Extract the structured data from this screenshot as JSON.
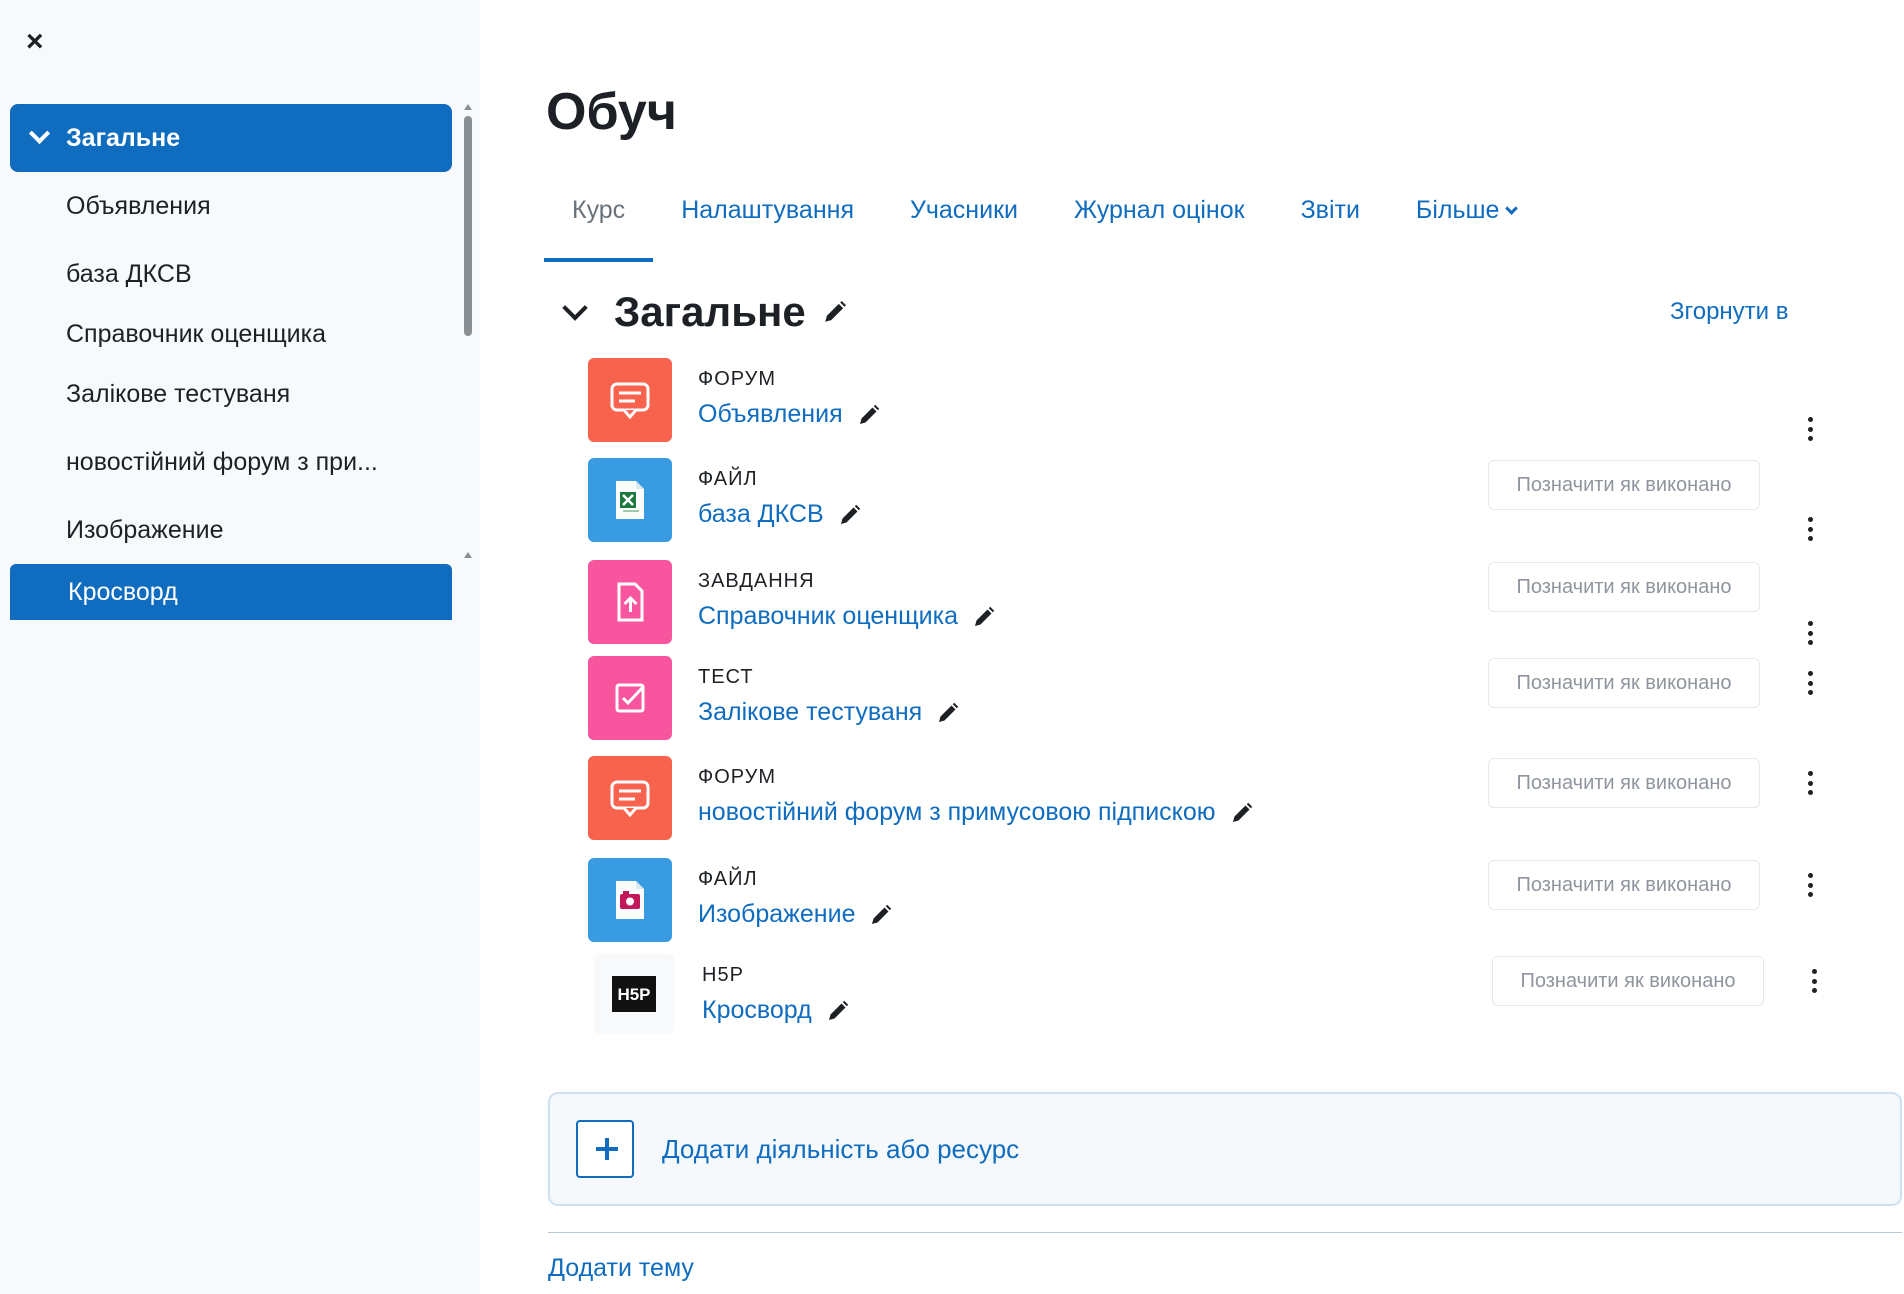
{
  "sidebar": {
    "close_label": "×",
    "items": [
      {
        "label": "Загальне",
        "active": true,
        "head": true
      },
      {
        "label": "Объявления"
      },
      {
        "label": "база ДКСВ"
      },
      {
        "label": "Справочник оценщика"
      },
      {
        "label": "Залікове тестуваня"
      },
      {
        "label": "новостійний форум з при..."
      },
      {
        "label": "Изображение"
      },
      {
        "label": "Кросворд",
        "active": true
      }
    ]
  },
  "header": {
    "title": "Обуч"
  },
  "tabs": [
    {
      "label": "Курс",
      "active": true
    },
    {
      "label": "Налаштування"
    },
    {
      "label": "Учасники"
    },
    {
      "label": "Журнал оцінок"
    },
    {
      "label": "Звіти"
    },
    {
      "label": "Більше",
      "dropdown": true
    }
  ],
  "section": {
    "title": "Загальне",
    "collapse_label": "Згорнути в"
  },
  "activities": [
    {
      "type": "ФОРУМ",
      "name": "Объявления",
      "icon": "forum-icon",
      "color": "#f7634d",
      "mark": ""
    },
    {
      "type": "ФАЙЛ",
      "name": "база ДКСВ",
      "icon": "spreadsheet-file-icon",
      "color": "#399be2",
      "mark": "Позначити як виконано"
    },
    {
      "type": "ЗАВДАННЯ",
      "name": "Справочник оценщика",
      "icon": "assignment-icon",
      "color": "#f7559e",
      "mark": "Позначити як виконано"
    },
    {
      "type": "ТЕСТ",
      "name": "Залікове тестуваня",
      "icon": "quiz-icon",
      "color": "#f7559e",
      "mark": "Позначити як виконано"
    },
    {
      "type": "ФОРУМ",
      "name": "новостійний форум з примусовою підпискою",
      "icon": "forum-icon",
      "color": "#f7634d",
      "mark": "Позначити як виконано"
    },
    {
      "type": "ФАЙЛ",
      "name": "Изображение",
      "icon": "image-file-icon",
      "color": "#399be2",
      "mark": "Позначити як виконано"
    },
    {
      "type": "H5P",
      "name": "Кросворд",
      "icon": "h5p-icon",
      "color": "#f8f9fa",
      "mark": "Позначити як виконано"
    }
  ],
  "add_activity": {
    "label": "Додати діяльність або ресурс"
  },
  "add_topic": {
    "label": "Додати тему"
  },
  "colors": {
    "primary": "#0f6cbf",
    "sidebar_bg": "#f8f9fa"
  }
}
